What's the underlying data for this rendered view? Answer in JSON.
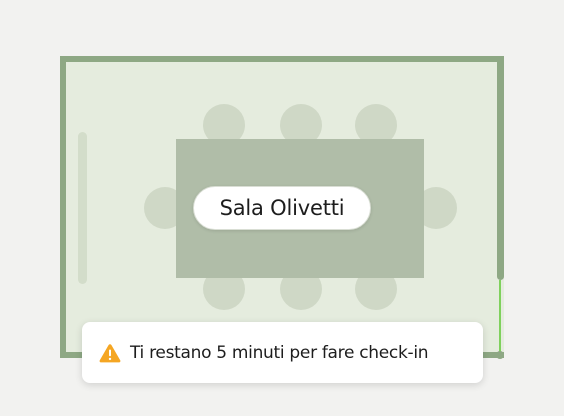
{
  "room": {
    "name": "Sala Olivetti",
    "wall_color": "#8ea884",
    "floor_color": "#e5ecde",
    "table_color": "#b0bda8",
    "chair_color": "#cfd8c6",
    "door_color": "#7fd15c",
    "chair_count": 8
  },
  "notification": {
    "icon": "warning-icon",
    "icon_color": "#f5a623",
    "message": "Ti restano 5 minuti per fare check-in"
  }
}
